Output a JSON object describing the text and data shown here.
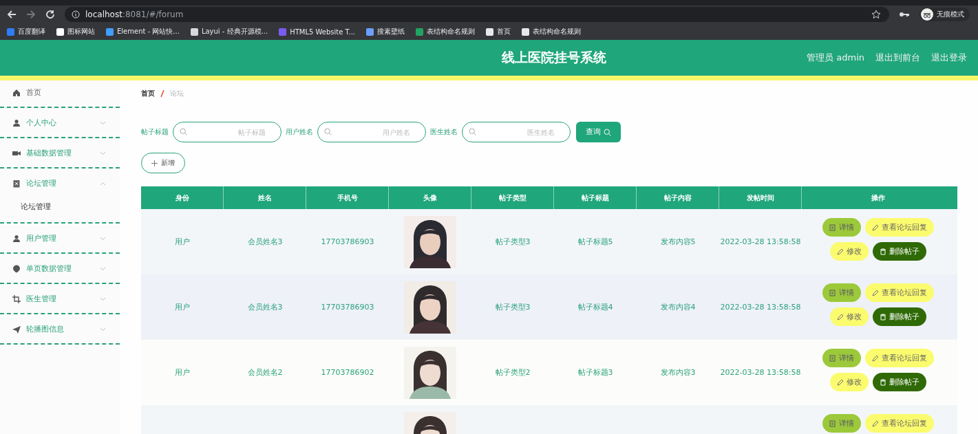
{
  "browser": {
    "url_host": "localhost",
    "url_path": ":8081/#/forum",
    "profile": "无痕模式",
    "bookmarks": [
      {
        "label": "百度翻译",
        "color": "#2f7cf6"
      },
      {
        "label": "图标网站",
        "color": "#ffffff"
      },
      {
        "label": "Element - 网站快...",
        "color": "#409eff"
      },
      {
        "label": "Layui - 经典开源模...",
        "color": "#d8d8d8"
      },
      {
        "label": "HTML5 Website T...",
        "color": "#7b5cf0"
      },
      {
        "label": "搜素壁纸",
        "color": "#6aa0ff"
      },
      {
        "label": "表结构命名规则",
        "color": "#1fa463"
      },
      {
        "label": "首页",
        "color": "#e8e8e8"
      },
      {
        "label": "表结构命名规则",
        "color": "#e8e8e8"
      }
    ]
  },
  "header": {
    "title": "线上医院挂号系统",
    "links": [
      "管理员 admin",
      "退出到前台",
      "退出登录"
    ]
  },
  "sidebar": {
    "items": [
      {
        "label": "首页"
      },
      {
        "label": "个人中心",
        "expanded": false
      },
      {
        "label": "基础数据管理",
        "expanded": false
      },
      {
        "label": "论坛管理",
        "expanded": true,
        "children": [
          {
            "label": "论坛管理"
          }
        ]
      },
      {
        "label": "用户管理",
        "expanded": false
      },
      {
        "label": "单页数据管理",
        "expanded": false
      },
      {
        "label": "医生管理",
        "expanded": false
      },
      {
        "label": "轮播图信息",
        "expanded": false
      }
    ]
  },
  "breadcrumb": [
    "首页",
    "论坛"
  ],
  "filters": [
    {
      "label": "帖子标题",
      "placeholder": "帖子标题"
    },
    {
      "label": "用户姓名",
      "placeholder": "用户姓名"
    },
    {
      "label": "医生姓名",
      "placeholder": "医生姓名"
    }
  ],
  "search_button": "查询",
  "add_button": "新增",
  "table": {
    "columns": [
      "身份",
      "姓名",
      "手机号",
      "头像",
      "帖子类型",
      "帖子标题",
      "帖子内容",
      "发帖时间",
      "操作"
    ],
    "rows": [
      {
        "cells": [
          "用户",
          "会员姓名3",
          "17703786903",
          null,
          "帖子类型3",
          "帖子标题5",
          "发布内容5",
          "2022-03-28 13:58:58"
        ],
        "avatar": {
          "kind": "picture"
        },
        "actions": [
          {
            "label": "详情",
            "kind": "detail"
          },
          {
            "label": "查看论坛回复",
            "kind": "reply"
          },
          {
            "label": "修改",
            "kind": "edit"
          },
          {
            "label": "删除帖子",
            "kind": "delete"
          }
        ]
      },
      {
        "cells": [
          "用户",
          "会员姓名3",
          "17703786903",
          null,
          "帖子类型3",
          "帖子标题4",
          "发布内容4",
          "2022-03-28 13:58:58"
        ],
        "avatar": {
          "kind": "picture"
        },
        "actions": [
          {
            "label": "详情",
            "kind": "detail"
          },
          {
            "label": "查看论坛回复",
            "kind": "reply"
          },
          {
            "label": "修改",
            "kind": "edit"
          },
          {
            "label": "删除帖子",
            "kind": "delete"
          }
        ]
      },
      {
        "cells": [
          "用户",
          "会员姓名2",
          "17703786902",
          null,
          "帖子类型2",
          "帖子标题3",
          "发布内容3",
          "2022-03-28 13:58:58"
        ],
        "avatar": {
          "kind": "picture"
        },
        "actions": [
          {
            "label": "详情",
            "kind": "detail"
          },
          {
            "label": "查看论坛回复",
            "kind": "reply"
          },
          {
            "label": "修改",
            "kind": "edit"
          },
          {
            "label": "删除帖子",
            "kind": "delete"
          }
        ]
      },
      {
        "avatar": {
          "kind": "picture"
        },
        "actions": [
          {
            "label": "详情",
            "kind": "detail"
          },
          {
            "label": "查看论坛回复",
            "kind": "reply"
          }
        ]
      }
    ]
  }
}
